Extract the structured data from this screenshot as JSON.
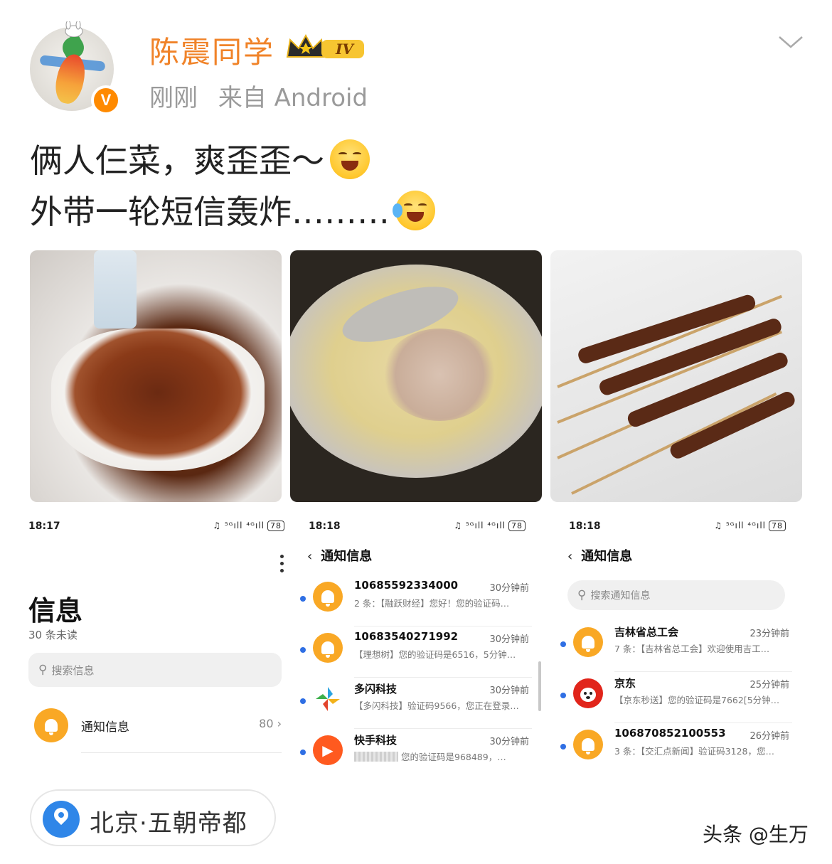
{
  "header": {
    "username": "陈震同学",
    "level_badge": "IV",
    "verified_badge": "V",
    "time": "刚刚",
    "source": "来自 Android"
  },
  "post": {
    "line1": "俩人仨菜，爽歪歪～",
    "line2": "外带一轮短信轰炸………"
  },
  "photos": [
    {
      "icon": "braised-beef-photo"
    },
    {
      "icon": "soup-pot-photo"
    },
    {
      "icon": "lamb-skewers-photo"
    }
  ],
  "screenA": {
    "time": "18:17",
    "status_icons": "♫ ⁵ᴳıll ⁴ᴳıll",
    "battery": "78",
    "title": "信息",
    "unread": "30 条未读",
    "search_placeholder": "搜索信息",
    "row_label": "通知信息",
    "row_count": "80 ›"
  },
  "screenB": {
    "time": "18:18",
    "status_icons": "♫ ⁵ᴳıll ⁴ᴳıll",
    "battery": "78",
    "nav_title": "通知信息",
    "messages": [
      {
        "sender": "10685592334000",
        "time": "30分钟前",
        "preview": "2 条：【融跃财经】您好！您的验证码…"
      },
      {
        "sender": "10683540271992",
        "time": "30分钟前",
        "preview": "【理想树】您的验证码是6516，5分钟…"
      },
      {
        "sender": "多闪科技",
        "time": "30分钟前",
        "preview": "【多闪科技】验证码9566，您正在登录…"
      },
      {
        "sender": "快手科技",
        "time": "30分钟前",
        "preview": "您的验证码是968489，…"
      }
    ]
  },
  "screenC": {
    "time": "18:18",
    "status_icons": "♫ ⁵ᴳıll ⁴ᴳıll",
    "battery": "78",
    "nav_title": "通知信息",
    "search_placeholder": "搜索通知信息",
    "messages": [
      {
        "sender": "吉林省总工会",
        "time": "23分钟前",
        "preview": "7 条：【吉林省总工会】欢迎使用吉工…"
      },
      {
        "sender": "京东",
        "time": "25分钟前",
        "preview": "【京东秒送】您的验证码是7662[5分钟…"
      },
      {
        "sender": "106870852100553",
        "time": "26分钟前",
        "preview": "3 条：【交汇点新闻】验证码3128，您…"
      }
    ]
  },
  "location": "北京·五朝帝都",
  "watermark": "头条 @生万",
  "colors": {
    "username": "#f08329",
    "verified": "#ff8a00",
    "notify_bell": "#f9a825",
    "unread_dot": "#2f6fe4",
    "location_pin": "#2f86e8"
  }
}
